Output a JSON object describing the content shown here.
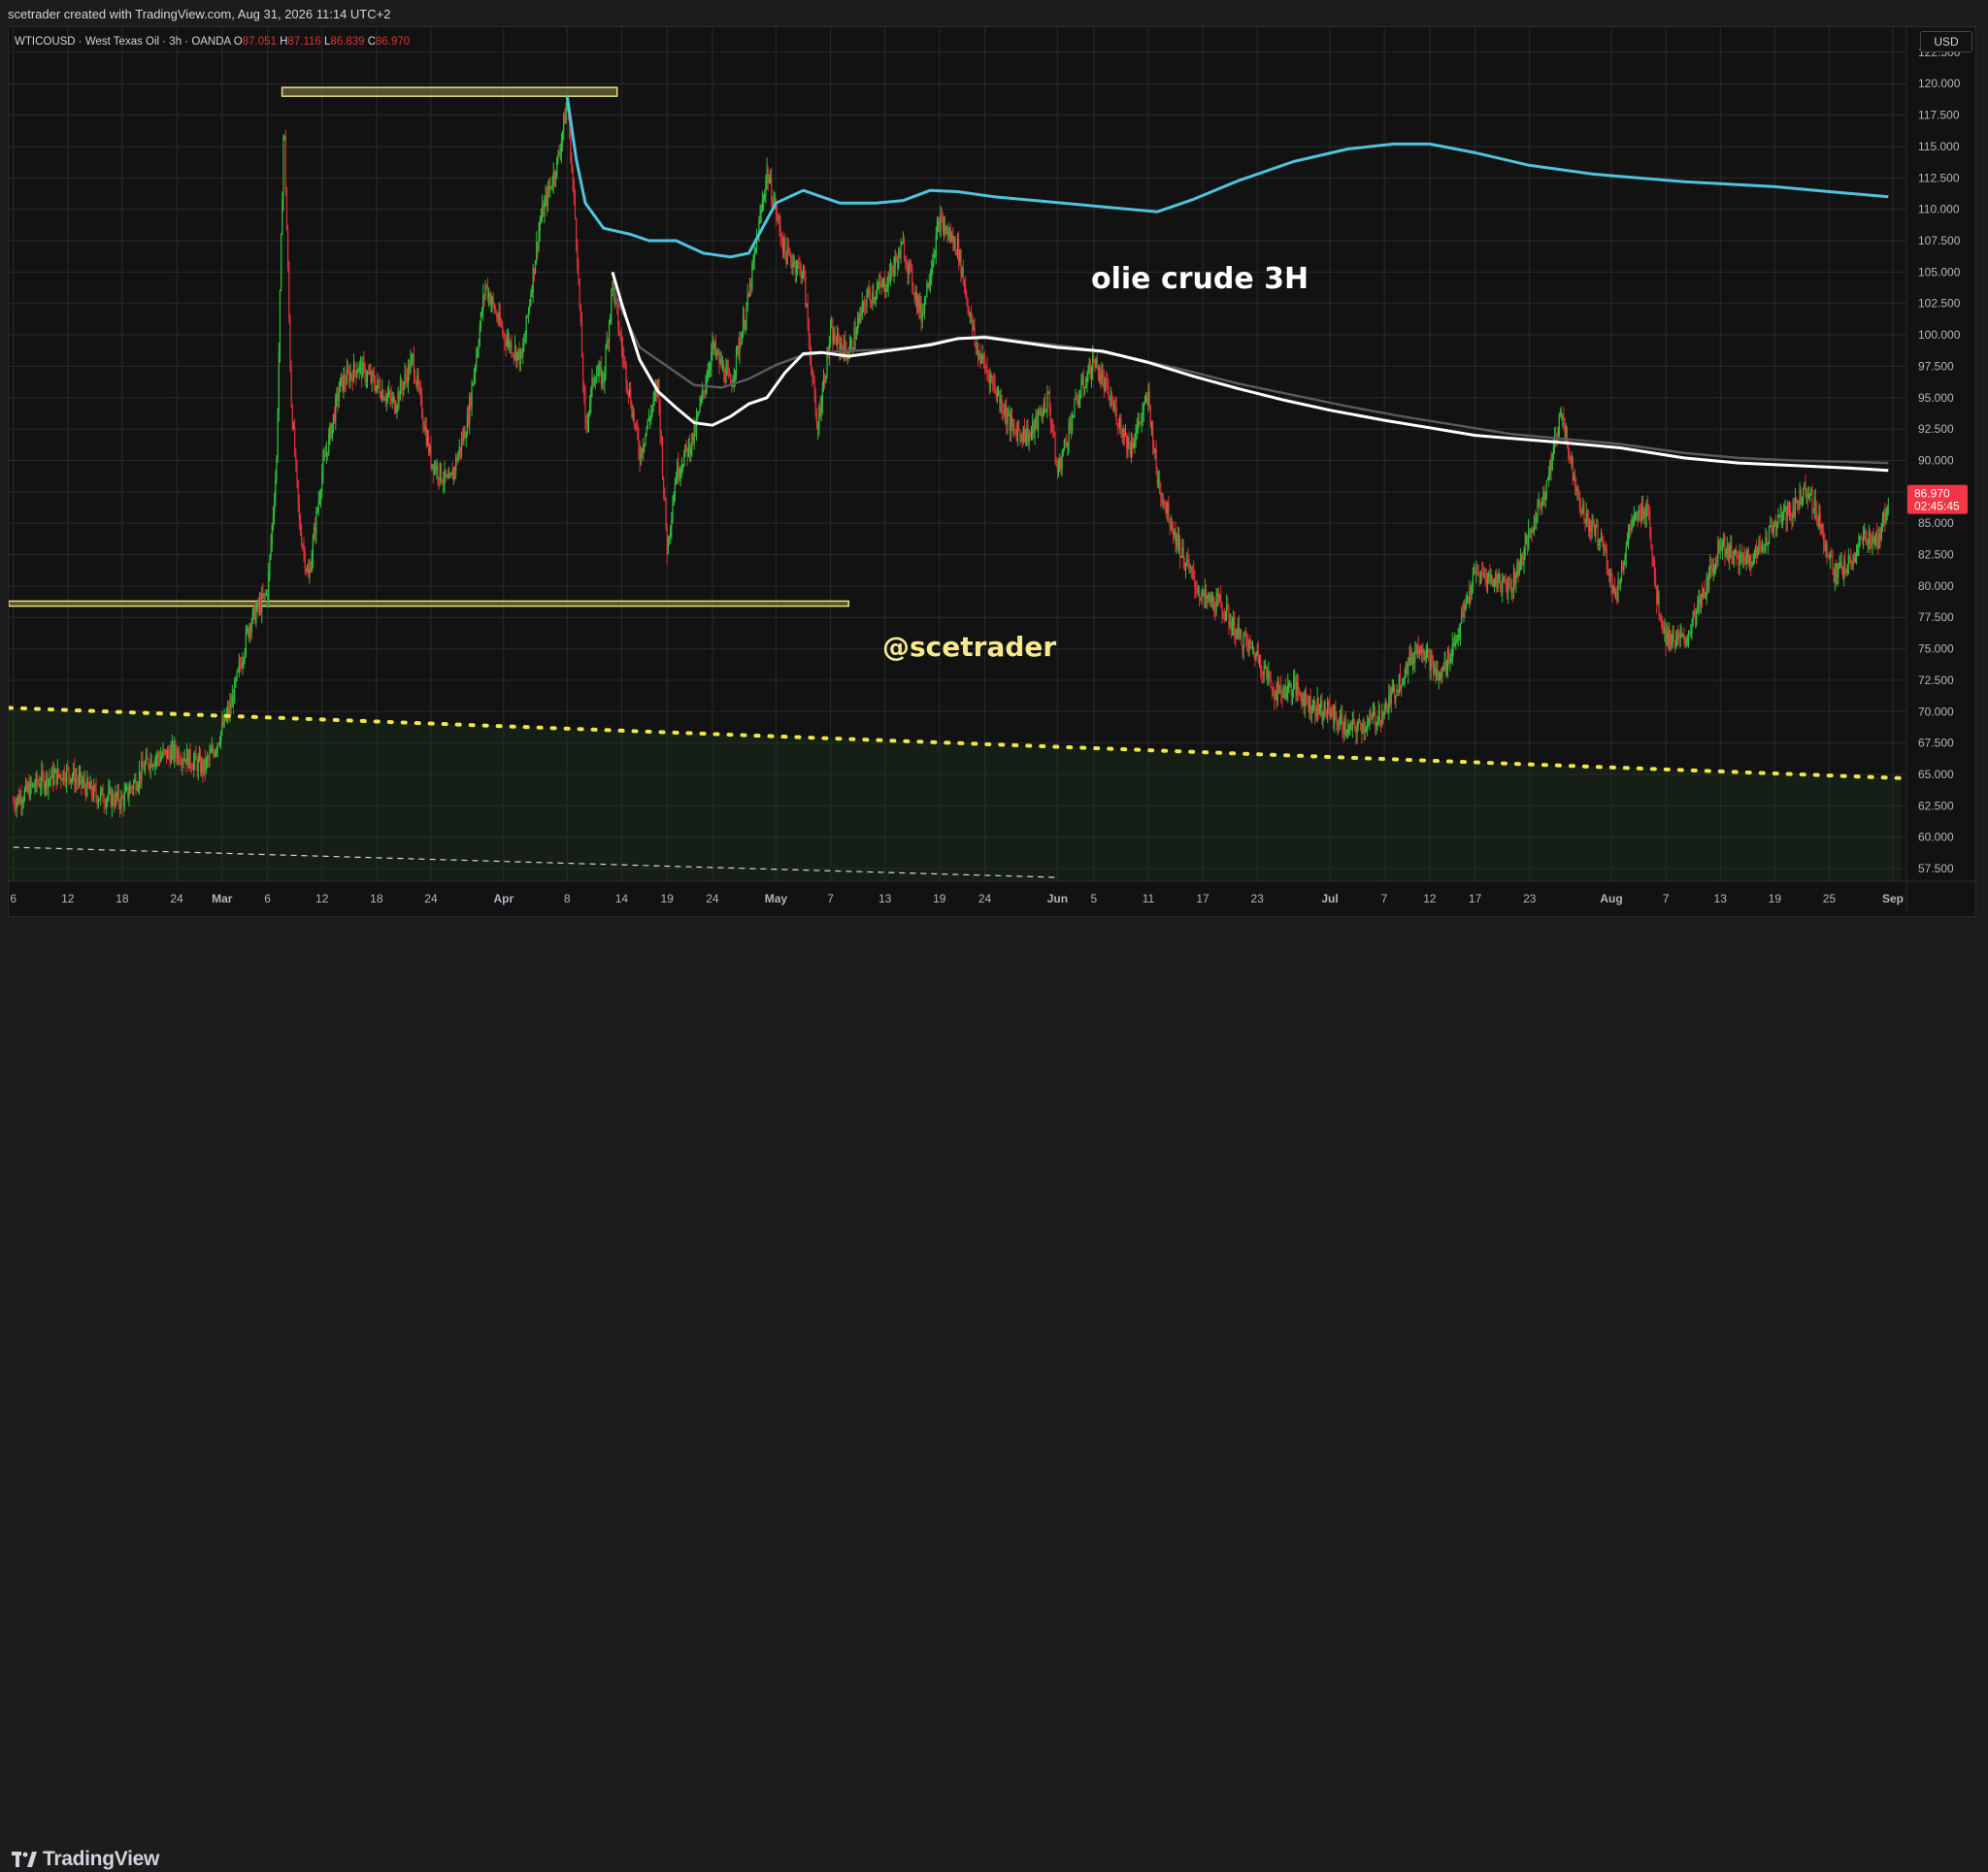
{
  "header": {
    "attribution": "scetrader created with TradingView.com, Aug 31, 2026 11:14 UTC+2"
  },
  "footer": {
    "brand": "TradingView"
  },
  "colors": {
    "up": "#26a69a",
    "up_candle": "#2fbf3a",
    "down": "#e0303a",
    "ma_cyan": "#4fc3dd",
    "ma_white": "#ffffff",
    "ma_gray": "#5a5a5a",
    "zone_line": "#e8e07a",
    "dotted_line": "#f0e64a",
    "price_label_bg": "#f23645"
  },
  "chart_data": {
    "type": "candlestick",
    "symbol_line": {
      "symbol": "WTICOUSD · West Texas Oil · 3h · OANDA",
      "o_label": "O",
      "o_value": "87.051",
      "h_label": "H",
      "h_value": "87.116",
      "l_label": "L",
      "l_value": "86.839",
      "c_label": "C",
      "c_value": "86.970"
    },
    "currency": "USD",
    "y_ticks": [
      "57.500",
      "60.000",
      "62.500",
      "65.000",
      "67.500",
      "70.000",
      "72.500",
      "75.000",
      "77.500",
      "80.000",
      "82.500",
      "85.000",
      "87.500",
      "90.000",
      "92.500",
      "95.000",
      "97.500",
      "100.000",
      "102.500",
      "105.000",
      "107.500",
      "110.000",
      "112.500",
      "115.000",
      "117.500",
      "120.000",
      "122.500"
    ],
    "ylim": [
      56.5,
      124.5
    ],
    "x_ticks": [
      {
        "label": "6",
        "day": 6
      },
      {
        "label": "12",
        "day": 12
      },
      {
        "label": "18",
        "day": 18
      },
      {
        "label": "24",
        "day": 24
      },
      {
        "label": "Mar",
        "day": 29
      },
      {
        "label": "6",
        "day": 34
      },
      {
        "label": "12",
        "day": 40
      },
      {
        "label": "18",
        "day": 46
      },
      {
        "label": "24",
        "day": 52
      },
      {
        "label": "Apr",
        "day": 60
      },
      {
        "label": "8",
        "day": 67
      },
      {
        "label": "14",
        "day": 73
      },
      {
        "label": "19",
        "day": 78
      },
      {
        "label": "24",
        "day": 83
      },
      {
        "label": "May",
        "day": 90
      },
      {
        "label": "7",
        "day": 96
      },
      {
        "label": "13",
        "day": 102
      },
      {
        "label": "19",
        "day": 108
      },
      {
        "label": "24",
        "day": 113
      },
      {
        "label": "Jun",
        "day": 121
      },
      {
        "label": "5",
        "day": 125
      },
      {
        "label": "11",
        "day": 131
      },
      {
        "label": "17",
        "day": 137
      },
      {
        "label": "23",
        "day": 143
      },
      {
        "label": "Jul",
        "day": 151
      },
      {
        "label": "7",
        "day": 157
      },
      {
        "label": "12",
        "day": 162
      },
      {
        "label": "17",
        "day": 167
      },
      {
        "label": "23",
        "day": 173
      },
      {
        "label": "Aug",
        "day": 182
      },
      {
        "label": "7",
        "day": 188
      },
      {
        "label": "13",
        "day": 194
      },
      {
        "label": "19",
        "day": 200
      },
      {
        "label": "25",
        "day": 206
      },
      {
        "label": "Sep",
        "day": 213
      }
    ],
    "xlim": [
      5.5,
      214.5
    ],
    "price_path": [
      [
        6,
        62.8
      ],
      [
        9,
        64.5
      ],
      [
        12,
        65.2
      ],
      [
        15,
        63.4
      ],
      [
        18,
        62.9
      ],
      [
        21,
        66.2
      ],
      [
        24,
        66.8
      ],
      [
        27,
        65.5
      ],
      [
        28,
        66.8
      ],
      [
        30,
        70.5
      ],
      [
        32,
        77.0
      ],
      [
        34,
        79.5
      ],
      [
        35,
        90.0
      ],
      [
        35.8,
        117.5
      ],
      [
        36.6,
        95.0
      ],
      [
        37.5,
        85.0
      ],
      [
        38.5,
        80.5
      ],
      [
        40,
        89.0
      ],
      [
        42,
        96.0
      ],
      [
        44,
        97.5
      ],
      [
        46,
        96.0
      ],
      [
        48,
        94.5
      ],
      [
        50,
        98.0
      ],
      [
        52,
        90.0
      ],
      [
        54,
        88.0
      ],
      [
        56,
        93.0
      ],
      [
        58,
        104.0
      ],
      [
        60,
        100.0
      ],
      [
        62,
        98.0
      ],
      [
        64,
        109.0
      ],
      [
        66,
        114.0
      ],
      [
        67,
        118.5
      ],
      [
        68,
        108.0
      ],
      [
        69,
        92.5
      ],
      [
        70,
        97.0
      ],
      [
        71,
        96.5
      ],
      [
        72,
        104.0
      ],
      [
        73,
        99.0
      ],
      [
        75,
        90.5
      ],
      [
        77,
        96.0
      ],
      [
        78,
        83.0
      ],
      [
        79,
        89.0
      ],
      [
        81,
        92.0
      ],
      [
        83,
        99.0
      ],
      [
        85,
        96.0
      ],
      [
        87,
        103.0
      ],
      [
        89,
        113.0
      ],
      [
        91,
        106.5
      ],
      [
        93,
        105.0
      ],
      [
        94.5,
        92.5
      ],
      [
        96,
        100.0
      ],
      [
        98,
        98.5
      ],
      [
        100,
        103.0
      ],
      [
        102,
        104.0
      ],
      [
        104,
        107.0
      ],
      [
        106,
        101.5
      ],
      [
        108,
        109.0
      ],
      [
        110,
        107.0
      ],
      [
        112,
        99.0
      ],
      [
        114,
        96.0
      ],
      [
        116,
        92.5
      ],
      [
        118,
        92.0
      ],
      [
        120,
        95.0
      ],
      [
        121,
        89.0
      ],
      [
        123,
        94.5
      ],
      [
        125,
        98.0
      ],
      [
        127,
        94.5
      ],
      [
        129,
        91.0
      ],
      [
        131,
        95.0
      ],
      [
        132,
        88.5
      ],
      [
        134,
        84.0
      ],
      [
        135,
        82.0
      ],
      [
        137,
        79.0
      ],
      [
        139,
        78.5
      ],
      [
        141,
        76.0
      ],
      [
        143,
        74.5
      ],
      [
        145,
        71.5
      ],
      [
        147,
        72.0
      ],
      [
        149,
        70.5
      ],
      [
        151,
        70.0
      ],
      [
        153,
        68.5
      ],
      [
        155,
        69.0
      ],
      [
        157,
        70.0
      ],
      [
        159,
        73.0
      ],
      [
        161,
        75.5
      ],
      [
        163,
        72.5
      ],
      [
        165,
        76.0
      ],
      [
        167,
        81.0
      ],
      [
        169,
        80.5
      ],
      [
        171,
        80.0
      ],
      [
        173,
        84.0
      ],
      [
        175,
        88.5
      ],
      [
        176.5,
        94.0
      ],
      [
        177.5,
        90.0
      ],
      [
        179,
        85.5
      ],
      [
        181,
        83.5
      ],
      [
        182.5,
        79.0
      ],
      [
        184,
        84.5
      ],
      [
        186,
        86.5
      ],
      [
        187,
        79.0
      ],
      [
        188,
        76.0
      ],
      [
        190,
        75.5
      ],
      [
        192,
        79.0
      ],
      [
        194,
        83.5
      ],
      [
        196,
        82.0
      ],
      [
        198,
        82.5
      ],
      [
        200,
        85.0
      ],
      [
        202,
        86.0
      ],
      [
        203.5,
        88.0
      ],
      [
        205,
        85.0
      ],
      [
        206.5,
        81.0
      ],
      [
        208,
        81.5
      ],
      [
        210,
        84.0
      ],
      [
        211.5,
        83.5
      ],
      [
        212.5,
        86.97
      ]
    ],
    "series": [
      {
        "name": "",
        "color": "cyan",
        "points": [
          [
            67,
            119.0
          ],
          [
            68,
            114.0
          ],
          [
            69,
            110.5
          ],
          [
            71,
            108.5
          ],
          [
            74,
            108.0
          ],
          [
            76,
            107.5
          ],
          [
            79,
            107.5
          ],
          [
            82,
            106.5
          ],
          [
            85,
            106.2
          ],
          [
            87,
            106.5
          ],
          [
            88.5,
            108.5
          ],
          [
            90,
            110.5
          ],
          [
            93,
            111.5
          ],
          [
            95,
            111.0
          ],
          [
            97,
            110.5
          ],
          [
            101,
            110.5
          ],
          [
            104,
            110.7
          ],
          [
            107,
            111.5
          ],
          [
            110,
            111.4
          ],
          [
            114,
            111.0
          ],
          [
            120,
            110.6
          ],
          [
            126,
            110.2
          ],
          [
            132,
            109.8
          ],
          [
            136,
            110.8
          ],
          [
            141,
            112.3
          ],
          [
            147,
            113.8
          ],
          [
            153,
            114.8
          ],
          [
            158,
            115.2
          ],
          [
            162,
            115.2
          ],
          [
            167,
            114.5
          ],
          [
            173,
            113.5
          ],
          [
            180,
            112.8
          ],
          [
            190,
            112.2
          ],
          [
            200,
            111.8
          ],
          [
            206,
            111.4
          ],
          [
            212.5,
            111.0
          ]
        ]
      },
      {
        "name": "",
        "color": "white",
        "points": [
          [
            72,
            105.0
          ],
          [
            73,
            102.5
          ],
          [
            75,
            98.0
          ],
          [
            77,
            95.5
          ],
          [
            79,
            94.2
          ],
          [
            81,
            93.0
          ],
          [
            83,
            92.8
          ],
          [
            85,
            93.5
          ],
          [
            87,
            94.5
          ],
          [
            89,
            95.0
          ],
          [
            91,
            97.0
          ],
          [
            93,
            98.5
          ],
          [
            95,
            98.6
          ],
          [
            98,
            98.3
          ],
          [
            101,
            98.6
          ],
          [
            104,
            98.9
          ],
          [
            107,
            99.2
          ],
          [
            110,
            99.7
          ],
          [
            113,
            99.8
          ],
          [
            117,
            99.4
          ],
          [
            121,
            99.0
          ],
          [
            126,
            98.7
          ],
          [
            131,
            97.8
          ],
          [
            136,
            96.7
          ],
          [
            141,
            95.7
          ],
          [
            146,
            94.8
          ],
          [
            151,
            94.0
          ],
          [
            157,
            93.2
          ],
          [
            162,
            92.6
          ],
          [
            167,
            92.0
          ],
          [
            172,
            91.7
          ],
          [
            177,
            91.4
          ],
          [
            183,
            91.0
          ],
          [
            190,
            90.2
          ],
          [
            196,
            89.8
          ],
          [
            202,
            89.6
          ],
          [
            208,
            89.4
          ],
          [
            212.5,
            89.2
          ]
        ]
      },
      {
        "name": "",
        "color": "gray",
        "points": [
          [
            72,
            103.5
          ],
          [
            75,
            99.0
          ],
          [
            78,
            97.5
          ],
          [
            81,
            96.0
          ],
          [
            84,
            95.8
          ],
          [
            87,
            96.5
          ],
          [
            90,
            97.6
          ],
          [
            93,
            98.4
          ],
          [
            97,
            98.7
          ],
          [
            101,
            98.8
          ],
          [
            105,
            99.0
          ],
          [
            109,
            99.6
          ],
          [
            113,
            99.9
          ],
          [
            118,
            99.4
          ],
          [
            123,
            99.0
          ],
          [
            129,
            98.2
          ],
          [
            135,
            97.2
          ],
          [
            141,
            96.1
          ],
          [
            147,
            95.2
          ],
          [
            153,
            94.3
          ],
          [
            159,
            93.5
          ],
          [
            165,
            92.8
          ],
          [
            171,
            92.1
          ],
          [
            177,
            91.7
          ],
          [
            183,
            91.3
          ],
          [
            190,
            90.6
          ],
          [
            196,
            90.2
          ],
          [
            202,
            90.0
          ],
          [
            208,
            89.9
          ],
          [
            212.5,
            89.8
          ]
        ]
      }
    ],
    "horizontal_zones": [
      {
        "x1": 35.6,
        "x2": 72.5,
        "y1": 119.0,
        "y2": 119.7
      },
      {
        "x1": 5.5,
        "x2": 98.0,
        "y1": 78.4,
        "y2": 78.8
      }
    ],
    "dotted_trendline": {
      "x1": 5.5,
      "y1": 70.3,
      "x2": 214,
      "y2": 64.7
    },
    "dashed_trendline": {
      "x1": 6,
      "y1": 59.2,
      "x2": 121,
      "y2": 56.8
    },
    "last_price": {
      "value": "86.970",
      "countdown": "02:45:45"
    },
    "annotations": {
      "title": "olie crude 3H",
      "handle": "@scetrader"
    }
  }
}
